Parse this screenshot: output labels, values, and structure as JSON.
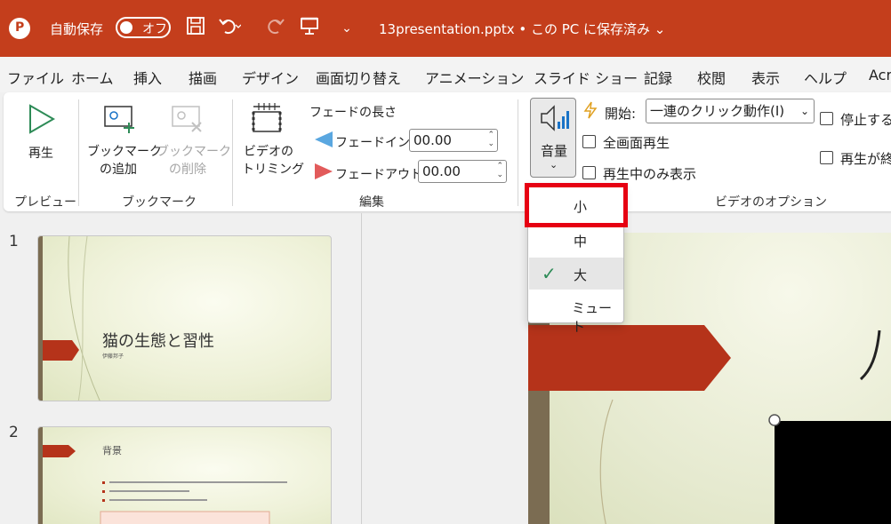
{
  "titlebar": {
    "autosave_label": "自動保存",
    "toggle_text": "オフ",
    "filename": "13presentation.pptx • この PC に保存済み ⌄",
    "colors": {
      "bar": "#c43e1c"
    }
  },
  "menu": {
    "tabs": [
      "ファイル",
      "ホーム",
      "挿入",
      "描画",
      "デザイン",
      "画面切り替え",
      "アニメーション",
      "スライド ショー",
      "記録",
      "校閲",
      "表示",
      "ヘルプ",
      "Acr"
    ]
  },
  "ribbon": {
    "preview": {
      "play_label": "再生",
      "group_label": "プレビュー"
    },
    "bookmark": {
      "add_label_1": "ブックマーク",
      "add_label_2": "の追加",
      "remove_label_1": "ブックマーク",
      "remove_label_2": "の削除",
      "group_label": "ブックマーク"
    },
    "edit": {
      "trim_label_1": "ビデオの",
      "trim_label_2": "トリミング",
      "fade_title": "フェードの長さ",
      "fade_in_label": "フェードイン:",
      "fade_in_value": "00.00",
      "fade_out_label": "フェードアウト:",
      "fade_out_value": "00.00",
      "group_label": "編集"
    },
    "options": {
      "volume_label": "音量",
      "start_label": "開始:",
      "start_value": "一連のクリック動作(I)",
      "fullscreen_label": "全画面再生",
      "hide_label": "再生中のみ表示",
      "stop_label": "停止する",
      "loop_label": "再生が終",
      "group_label": "ビデオのオプション"
    }
  },
  "volume_dropdown": {
    "items": [
      {
        "label": "小",
        "selected": false,
        "highlighted": true
      },
      {
        "label": "中",
        "selected": false
      },
      {
        "label": "大",
        "selected": true
      },
      {
        "label": "ミュート",
        "selected": false
      }
    ],
    "check_mark": "✓"
  },
  "slides": [
    {
      "number": "1",
      "title": "猫の生態と習性",
      "subtitle": "伊藤邦子"
    },
    {
      "number": "2",
      "title": "背景"
    }
  ]
}
